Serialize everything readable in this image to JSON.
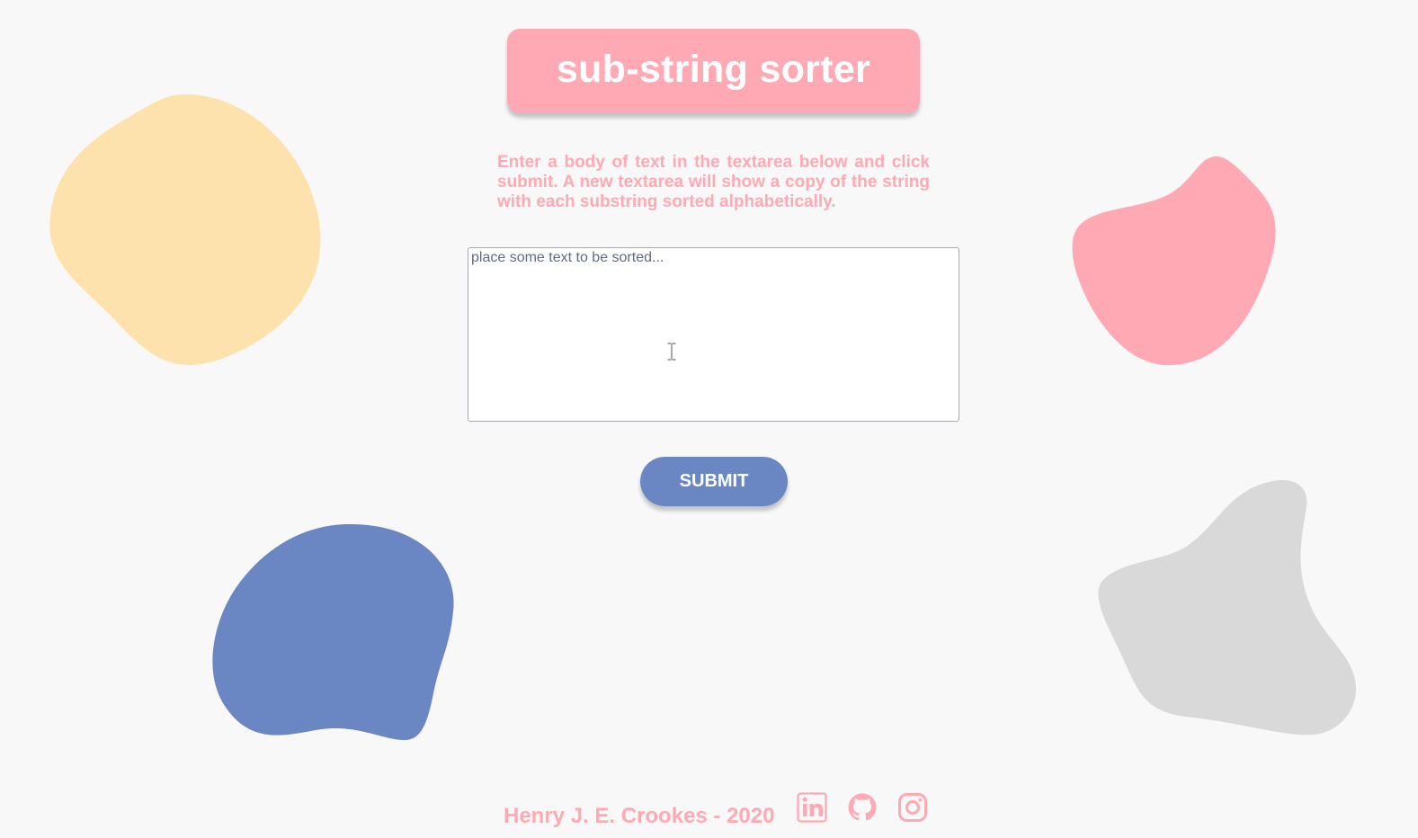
{
  "header": {
    "title": "sub-string sorter"
  },
  "instructions": "Enter a body of text in the textarea below and click submit. A new textarea will show a copy of the string with each substring sorted alphabetically.",
  "input": {
    "value": "",
    "placeholder": "place some text to be sorted..."
  },
  "submit": {
    "label": "SUBMIT"
  },
  "footer": {
    "credit": "Henry J. E. Crookes - 2020",
    "social": [
      "linkedin-icon",
      "github-icon",
      "instagram-icon"
    ]
  },
  "colors": {
    "background": "#f8f8f8",
    "pink": "#ffa9b5",
    "blue": "#6a87c4",
    "yellow": "#fee2ae",
    "gray": "#d9d9d9",
    "white": "#ffffff"
  }
}
